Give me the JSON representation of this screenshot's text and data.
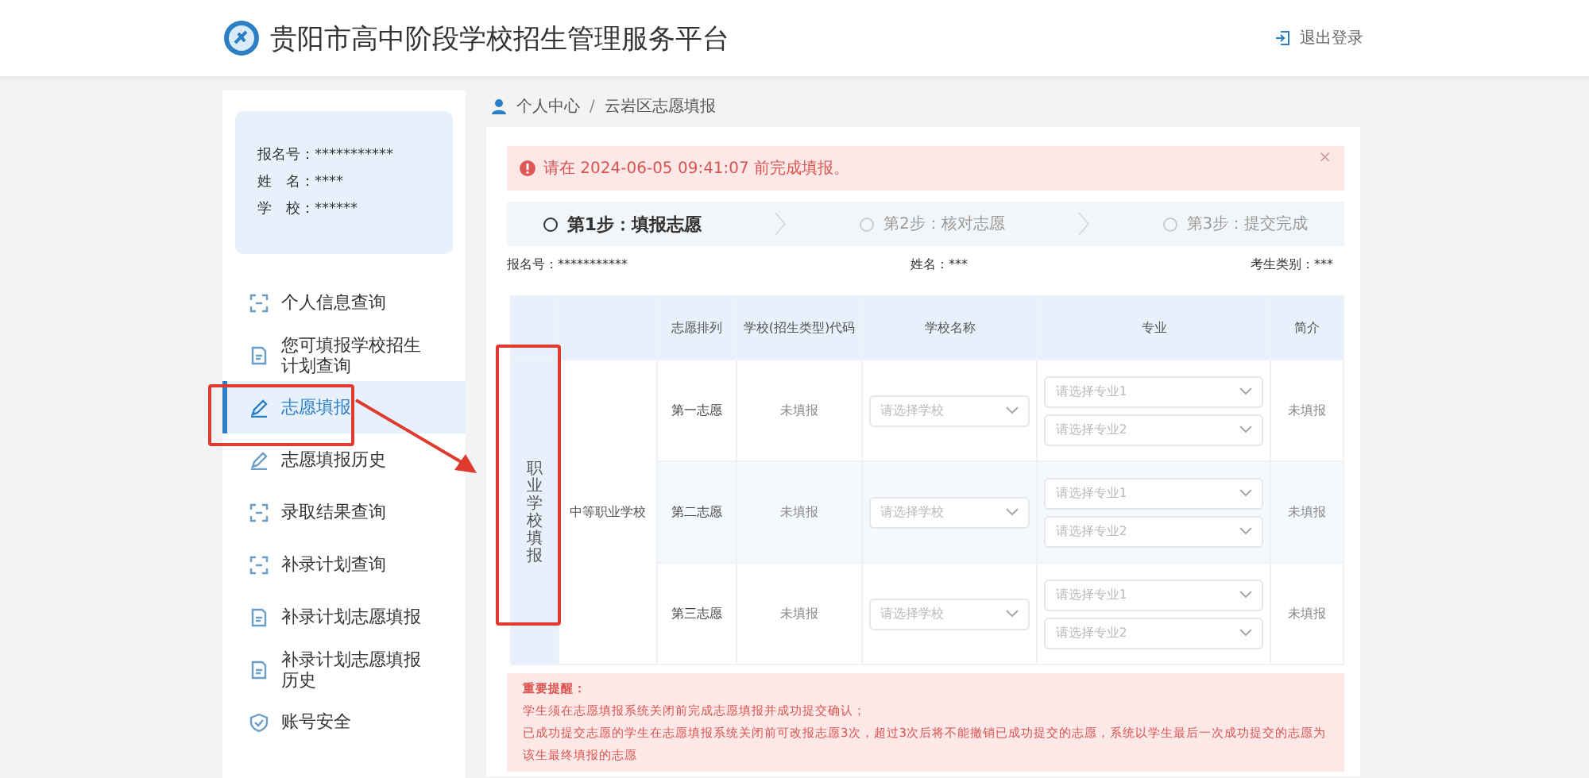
{
  "header": {
    "title": "贵阳市高中阶段学校招生管理服务平台",
    "logout": "退出登录"
  },
  "sidebar": {
    "info": [
      {
        "label": "报名号：",
        "value": "***********"
      },
      {
        "label": "姓　名：",
        "value": "****"
      },
      {
        "label": "学　校：",
        "value": "******"
      }
    ],
    "items": [
      {
        "label": "个人信息查询",
        "kind": "scan",
        "selected": false
      },
      {
        "label": "您可填报学校招生计划查询",
        "kind": "doc",
        "selected": false
      },
      {
        "label": "志愿填报",
        "kind": "pen",
        "selected": true
      },
      {
        "label": "志愿填报历史",
        "kind": "pen",
        "selected": false
      },
      {
        "label": "录取结果查询",
        "kind": "scan",
        "selected": false
      },
      {
        "label": "补录计划查询",
        "kind": "scan",
        "selected": false
      },
      {
        "label": "补录计划志愿填报",
        "kind": "doc",
        "selected": false
      },
      {
        "label": "补录计划志愿填报历史",
        "kind": "doc",
        "selected": false
      },
      {
        "label": "账号安全",
        "kind": "shield",
        "selected": false
      }
    ]
  },
  "breadcrumb": {
    "items": [
      "个人中心",
      "云岩区志愿填报"
    ],
    "separator": "/"
  },
  "alert": {
    "text": "请在 2024-06-05 09:41:07 前完成填报。",
    "close": "×"
  },
  "steps": [
    {
      "label": "第1步：填报志愿",
      "selected": true
    },
    {
      "label": "第2步：核对志愿",
      "selected": false
    },
    {
      "label": "第3步：提交完成",
      "selected": false
    }
  ],
  "candidate": [
    {
      "label": "报名号：",
      "value": "***********"
    },
    {
      "label": "姓名：",
      "value": "***"
    },
    {
      "label": "考生类别：",
      "value": "***"
    }
  ],
  "table": {
    "columns": [
      "志愿排列",
      "学校(招生类型)代码",
      "学校名称",
      "专业",
      "简介"
    ],
    "group": "职业学校填报",
    "category": "中等职业学校",
    "rows": [
      {
        "rank": "第一志愿",
        "code": "未填报",
        "school": "请选择学校",
        "majors": [
          "请选择专业1",
          "请选择专业2"
        ],
        "intro": "未填报"
      },
      {
        "rank": "第二志愿",
        "code": "未填报",
        "school": "请选择学校",
        "majors": [
          "请选择专业1",
          "请选择专业2"
        ],
        "intro": "未填报"
      },
      {
        "rank": "第三志愿",
        "code": "未填报",
        "school": "请选择学校",
        "majors": [
          "请选择专业1",
          "请选择专业2"
        ],
        "intro": "未填报"
      }
    ]
  },
  "notice": {
    "title": "重要提醒：",
    "lines": [
      "学生须在志愿填报系统关闭前完成志愿填报并成功提交确认；",
      "已成功提交志愿的学生在志愿填报系统关闭前可改报志愿3次，超过3次后将不能撤销已成功提交的志愿，系统以学生最后一次成功提交的志愿为",
      "该生最终填报的志愿"
    ]
  }
}
